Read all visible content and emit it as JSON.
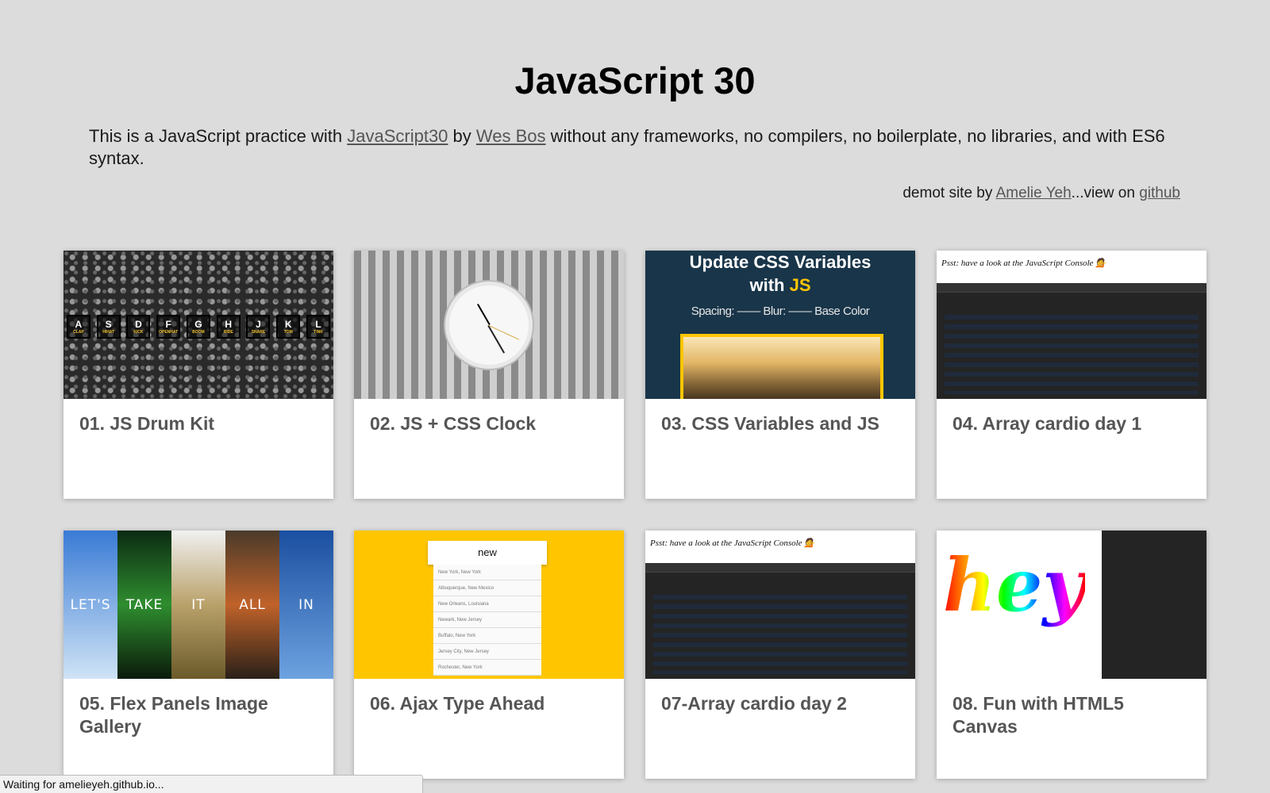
{
  "header": {
    "title": "JavaScript 30",
    "intro_before": "This is a JavaScript practice with ",
    "link_js30": "JavaScript30",
    "intro_by": " by ",
    "link_wes": "Wes Bos",
    "intro_after": " without any frameworks, no compilers, no boilerplate, no libraries, and with ES6 syntax.",
    "credit_before": "demot site by ",
    "link_author": "Amelie Yeh",
    "credit_mid": "...view on ",
    "link_github": "github"
  },
  "cards": [
    {
      "title": "01. JS Drum Kit"
    },
    {
      "title": "02. JS + CSS Clock"
    },
    {
      "title": "03. CSS Variables and JS"
    },
    {
      "title": "04. Array cardio day 1"
    },
    {
      "title": "05. Flex Panels Image Gallery"
    },
    {
      "title": "06. Ajax Type Ahead"
    },
    {
      "title": "07-Array cardio day 2"
    },
    {
      "title": "08. Fun with HTML5 Canvas"
    }
  ],
  "thumbs": {
    "drum_keys": [
      {
        "key": "A",
        "sound": "CLAP"
      },
      {
        "key": "S",
        "sound": "HIHAT"
      },
      {
        "key": "D",
        "sound": "KICK"
      },
      {
        "key": "F",
        "sound": "OPENHAT"
      },
      {
        "key": "G",
        "sound": "BOOM"
      },
      {
        "key": "H",
        "sound": "RIDE"
      },
      {
        "key": "J",
        "sound": "SNARE"
      },
      {
        "key": "K",
        "sound": "TOM"
      },
      {
        "key": "L",
        "sound": "TINK"
      }
    ],
    "vars_heading_line1": "Update CSS Variables",
    "vars_heading_with": "with ",
    "vars_heading_js": "JS",
    "vars_controls": "Spacing: —— Blur: —— Base Color",
    "psst": "Psst: have a look at the JavaScript Console 💁",
    "flex_words": [
      "LET'S",
      "TAKE",
      "IT",
      "ALL",
      "IN"
    ],
    "type_query": "new",
    "type_rows": [
      "New York, New York",
      "Albuquerque, New Mexico",
      "New Orleans, Louisiana",
      "Newark, New Jersey",
      "Buffalo, New York",
      "Jersey City, New Jersey",
      "Rochester, New York"
    ],
    "canvas_word": "hey"
  },
  "status": {
    "text": "Waiting for amelieyeh.github.io..."
  },
  "colors": {
    "background": "#dcdcdc",
    "accent_yellow": "#ffc600",
    "vars_bg": "#193549"
  }
}
